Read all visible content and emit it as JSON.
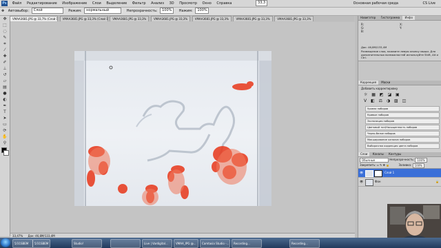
{
  "menubar": {
    "logo": "Ps",
    "items": [
      "Файл",
      "Редактирование",
      "Изображение",
      "Слои",
      "Выделение",
      "Фильтр",
      "Анализ",
      "3D",
      "Просмотр",
      "Окно",
      "Справка"
    ],
    "zoom": "33,3",
    "workspace": "Основная рабочая среда",
    "cs_live": "CS Live"
  },
  "optionsbar": {
    "auto_select_label": "Автовыбор:",
    "auto_select_value": "Слой",
    "mode_label": "Режим:",
    "mode_value": "нормальный",
    "opacity_label": "Непрозрачность:",
    "opacity_value": "100%",
    "flow_label": "Нажим:",
    "flow_value": "100%"
  },
  "tabs": [
    {
      "label": "VMAA3681.JPG @ 33,7% (Слой 1, Слой-маска/8)",
      "active": true
    },
    {
      "label": "VMAA3681.JPG @ 33,3% (Слой 1)",
      "active": false
    },
    {
      "label": "VMAA3681.JPG @ 33,3%",
      "active": false
    },
    {
      "label": "VMAA3681.JPG @ 33,3%",
      "active": false
    },
    {
      "label": "VMAA3681.JPG @ 33,3%",
      "active": false
    },
    {
      "label": "VMAA3681.JPG @ 33,3%",
      "active": false
    },
    {
      "label": "VMAA3681.JPG @ 33,3%",
      "active": false
    },
    {
      "label": "VMAA3681.JPG @ 33,3%",
      "active": false
    }
  ],
  "status": {
    "zoom": "33,47%",
    "doc": "Док: 46,8M/133,4M"
  },
  "panels": {
    "info_tabs": [
      "Навигатор",
      "Гистограмма",
      "Инфо"
    ],
    "info_rows": [
      "R:",
      "G:",
      "B:",
      "X:",
      "Y:"
    ],
    "info_doc": "Док: 46,8M/133,4M",
    "info_hint": "Размещение слоя, нажмите левую кнопку мыши. Для дополнительных возможностей используйте Shift, Alt и Ctrl.",
    "adj_tabs": [
      "Коррекция",
      "Маски"
    ],
    "adj_title": "Добавить корректировку",
    "adj_presets": [
      "Уровни наборов",
      "Кривые наборов",
      "Экспозиция наборов",
      "Цветовой тон/Насыщенность наборов",
      "Черно-белое наборов",
      "Микширование каналов наборов",
      "Выборочная коррекция цвета наборов"
    ],
    "layer_tabs": [
      "Слои",
      "Каналы",
      "Контуры"
    ],
    "blend": "Обычные",
    "opacity_label": "Непрозрачность:",
    "opacity_value": "100%",
    "lock_label": "Закрепить:",
    "fill_label": "Заливка:",
    "fill_value": "100%",
    "layers": [
      {
        "name": "Слой 1",
        "selected": true
      },
      {
        "name": "Фон",
        "selected": false
      }
    ]
  },
  "taskbar": {
    "tasks": [
      {
        "label": "5/31SBEM",
        "active": false
      },
      {
        "label": "5/31SBEM",
        "active": false
      },
      {
        "label": "Studio!",
        "active": false
      },
      {
        "label": "",
        "active": false
      },
      {
        "label": "Live | Vardigital...",
        "active": false
      },
      {
        "label": "VMAA_IPG @...",
        "active": false
      },
      {
        "label": "Camtasia Studio -...",
        "active": false
      },
      {
        "label": "Recording...",
        "active": false
      },
      {
        "label": "Recording...",
        "active": false
      }
    ]
  },
  "colors": {
    "red_ink": "#e8371a",
    "selected_layer": "#3a6fd8"
  }
}
